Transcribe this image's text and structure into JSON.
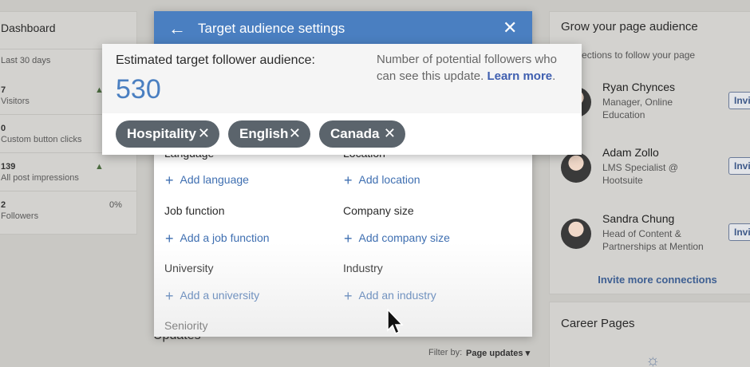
{
  "background": {
    "dashboard": {
      "title": "Dashboard",
      "period": "Last 30 days",
      "stats": [
        {
          "value": "7",
          "label": "Visitors",
          "trend": "▲"
        },
        {
          "value": "0",
          "label": "Custom button clicks",
          "trend": ""
        },
        {
          "value": "139",
          "label": "All post impressions",
          "trend": "▲"
        },
        {
          "value": "2",
          "label": "Followers",
          "trend": "0%"
        }
      ]
    },
    "grow": {
      "title": "Grow your page audience",
      "subtitle": "connections to follow your page",
      "people": [
        {
          "name": "Ryan Chynces",
          "role": "Manager, Online Education",
          "invite": "Invite"
        },
        {
          "name": "Adam Zollo",
          "role": "LMS Specialist @ Hootsuite",
          "invite": "Invite"
        },
        {
          "name": "Sandra Chung",
          "role": "Head of Content & Partnerships at Mention",
          "invite": "Invite"
        }
      ],
      "invite_more": "Invite more connections"
    },
    "career": {
      "title": "Career Pages"
    },
    "updates": {
      "title": "Updates",
      "filter_label": "Filter by:",
      "filter_value": "Page updates ▾"
    }
  },
  "modal": {
    "title": "Target audience settings",
    "fields": [
      {
        "label": "Language",
        "add": "Add language"
      },
      {
        "label": "Location",
        "add": "Add location"
      },
      {
        "label": "Job function",
        "add": "Add a job function"
      },
      {
        "label": "Company size",
        "add": "Add company size"
      },
      {
        "label": "University",
        "add": "Add a university"
      },
      {
        "label": "Industry",
        "add": "Add an industry"
      },
      {
        "label": "Seniority",
        "add": ""
      }
    ]
  },
  "estimate": {
    "label": "Estimated target follower audience:",
    "count": "530",
    "note": "Number of potential followers who can see this update.",
    "learn_more": "Learn more",
    "chips": [
      "Hospitality",
      "English",
      "Canada"
    ]
  },
  "icons": {
    "plus": "+",
    "close": "✕",
    "back": "←",
    "chip_remove": "✕"
  },
  "colors": {
    "accent": "#4a7fc1",
    "chip": "#5b646c",
    "link": "#3f6fb1"
  }
}
